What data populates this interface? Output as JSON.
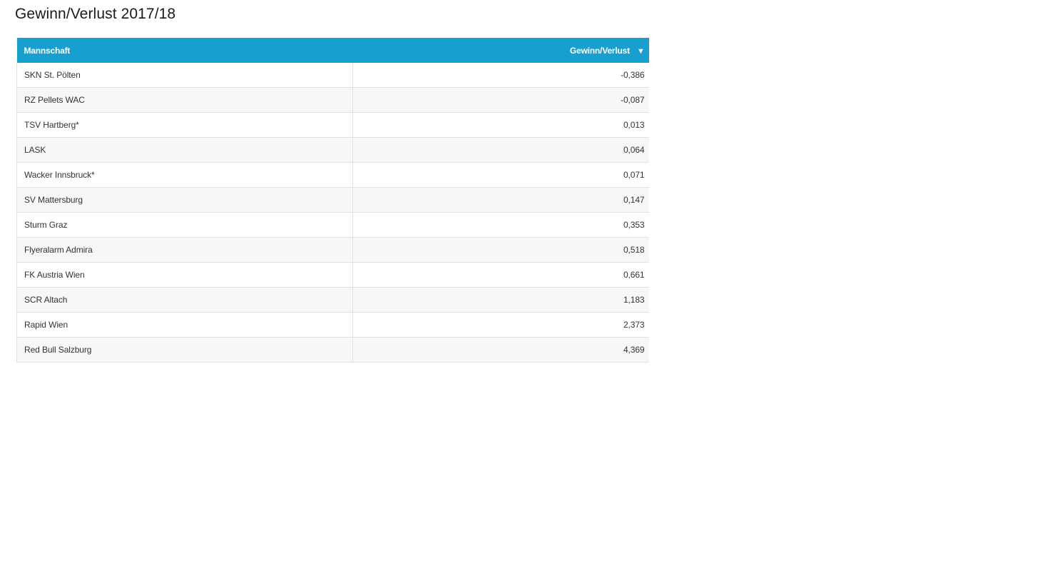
{
  "title": "Gewinn/Verlust 2017/18",
  "table": {
    "columns": {
      "team": "Mannschaft",
      "value": "Gewinn/Verlust",
      "sort_indicator": "▼"
    },
    "rows": [
      {
        "team": "SKN St. Pölten",
        "value": "-0,386"
      },
      {
        "team": "RZ Pellets WAC",
        "value": "-0,087"
      },
      {
        "team": "TSV Hartberg*",
        "value": "0,013"
      },
      {
        "team": "LASK",
        "value": "0,064"
      },
      {
        "team": "Wacker Innsbruck*",
        "value": "0,071"
      },
      {
        "team": "SV Mattersburg",
        "value": "0,147"
      },
      {
        "team": "Sturm Graz",
        "value": "0,353"
      },
      {
        "team": "Flyeralarm Admira",
        "value": "0,518"
      },
      {
        "team": "FK Austria Wien",
        "value": "0,661"
      },
      {
        "team": "SCR Altach",
        "value": "1,183"
      },
      {
        "team": "Rapid Wien",
        "value": "2,373"
      },
      {
        "team": "Red Bull Salzburg",
        "value": "4,369"
      }
    ]
  },
  "colors": {
    "header_background": "#189fcf",
    "header_text": "#ffffff",
    "row_alt_background": "#f7f7f7"
  }
}
